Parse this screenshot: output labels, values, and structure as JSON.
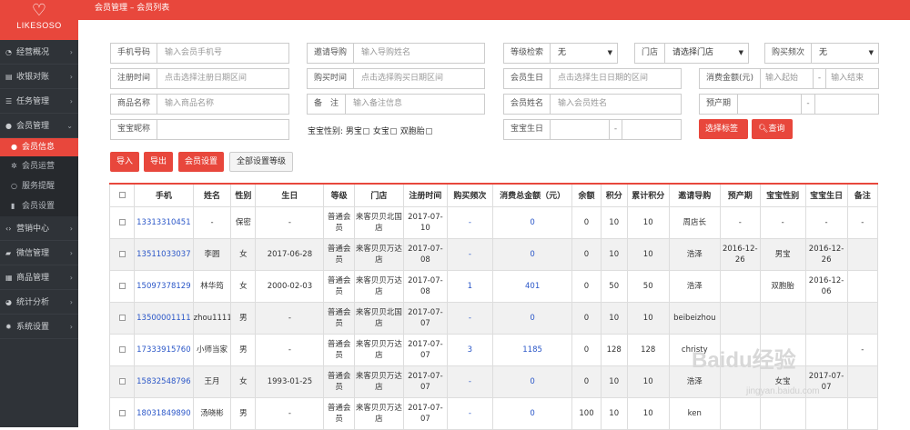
{
  "brand": "LIKESOSO",
  "breadcrumb": "会员管理 – 会员列表",
  "menu": [
    {
      "label": "经营概况",
      "icon": "gauge-icon"
    },
    {
      "label": "收银对账",
      "icon": "chart-icon"
    },
    {
      "label": "任务管理",
      "icon": "list-icon"
    },
    {
      "label": "会员管理",
      "icon": "users-icon"
    }
  ],
  "submenu": [
    {
      "label": "会员信息",
      "icon": "user-icon"
    },
    {
      "label": "会员运营",
      "icon": "cogs-icon"
    },
    {
      "label": "服务提醒",
      "icon": "comment-icon"
    },
    {
      "label": "会员设置",
      "icon": "tablet-icon"
    }
  ],
  "menu2": [
    {
      "label": "营销中心",
      "icon": "code-icon"
    },
    {
      "label": "微信管理",
      "icon": "folder-icon"
    },
    {
      "label": "商品管理",
      "icon": "cubes-icon"
    },
    {
      "label": "统计分析",
      "icon": "pie-icon"
    },
    {
      "label": "系统设置",
      "icon": "gear-icon"
    }
  ],
  "filters": {
    "phone": {
      "label": "手机号码",
      "placeholder": "输入会员手机号"
    },
    "guide": {
      "label": "邀请导购",
      "placeholder": "输入导购姓名"
    },
    "level": {
      "label": "等级检索",
      "value": "无"
    },
    "store": {
      "label": "门店",
      "value": "请选择门店"
    },
    "freq": {
      "label": "购买频次",
      "value": "无"
    },
    "regtime": {
      "label": "注册时间",
      "placeholder": "点击选择注册日期区间"
    },
    "buytime": {
      "label": "购买时间",
      "placeholder": "点击选择购买日期区间"
    },
    "birthday": {
      "label": "会员生日",
      "placeholder": "点击选择生日日期的区间"
    },
    "amount": {
      "label": "消费金额(元)",
      "from": "输入起始",
      "sep": "-",
      "to": "输入结束"
    },
    "goods": {
      "label": "商品名称",
      "placeholder": "输入商品名称"
    },
    "note": {
      "label": "备　注",
      "placeholder": "输入备注信息"
    },
    "name": {
      "label": "会员姓名",
      "placeholder": "输入会员姓名"
    },
    "due": {
      "label": "预产期",
      "sep": "-"
    },
    "babyname": {
      "label": "宝宝昵称"
    },
    "babybirth": {
      "label": "宝宝生日",
      "sep": "-"
    },
    "babysex": {
      "label": "宝宝性别:",
      "opt1": "男宝",
      "opt2": "女宝",
      "opt3": "双胞胎"
    }
  },
  "buttons": {
    "select_tag": "选择标签",
    "query": "查询",
    "import": "导入",
    "export": "导出",
    "member_settings": "会员设置",
    "set_all_level": "全部设置等级"
  },
  "table": {
    "headers": [
      "",
      "手机",
      "姓名",
      "性别",
      "生日",
      "等级",
      "门店",
      "注册时间",
      "购买频次",
      "消费总金额（元）",
      "余额",
      "积分",
      "累计积分",
      "邀请导购",
      "预产期",
      "宝宝性别",
      "宝宝生日",
      "备注"
    ],
    "rows": [
      [
        "13313310451",
        "-",
        "保密",
        "-",
        "普通会员",
        "来客贝贝北国店",
        "2017-07-10",
        "-",
        "0",
        "0",
        "10",
        "10",
        "周店长",
        "-",
        "-",
        "-",
        "-"
      ],
      [
        "13511033037",
        "李圆",
        "女",
        "2017-06-28",
        "普通会员",
        "来客贝贝万达店",
        "2017-07-08",
        "-",
        "0",
        "0",
        "10",
        "10",
        "浩泽",
        "2016-12-26",
        "男宝",
        "2016-12-26",
        ""
      ],
      [
        "15097378129",
        "林华筠",
        "女",
        "2000-02-03",
        "普通会员",
        "来客贝贝万达店",
        "2017-07-08",
        "1",
        "401",
        "0",
        "50",
        "50",
        "浩泽",
        "",
        "双胞胎",
        "2016-12-06",
        ""
      ],
      [
        "13500001111",
        "zhou1111",
        "男",
        "-",
        "普通会员",
        "来客贝贝北国店",
        "2017-07-07",
        "-",
        "0",
        "0",
        "10",
        "10",
        "beibeizhou",
        "",
        "",
        "",
        ""
      ],
      [
        "17333915760",
        "小师当家",
        "男",
        "-",
        "普通会员",
        "来客贝贝万达店",
        "2017-07-07",
        "3",
        "1185",
        "0",
        "128",
        "128",
        "christy",
        "",
        "",
        "",
        "-"
      ],
      [
        "15832548796",
        "王月",
        "女",
        "1993-01-25",
        "普通会员",
        "来客贝贝万达店",
        "2017-07-07",
        "-",
        "0",
        "0",
        "10",
        "10",
        "浩泽",
        "",
        "女宝",
        "2017-07-07",
        ""
      ],
      [
        "18031849890",
        "汤晓彬",
        "男",
        "-",
        "普通会员",
        "来客贝贝万达店",
        "2017-07-07",
        "-",
        "0",
        "100",
        "10",
        "10",
        "ken",
        "",
        "",
        "",
        ""
      ]
    ]
  },
  "watermark": {
    "main": "Baidu经验",
    "sub": "jingyan.baidu.com"
  }
}
